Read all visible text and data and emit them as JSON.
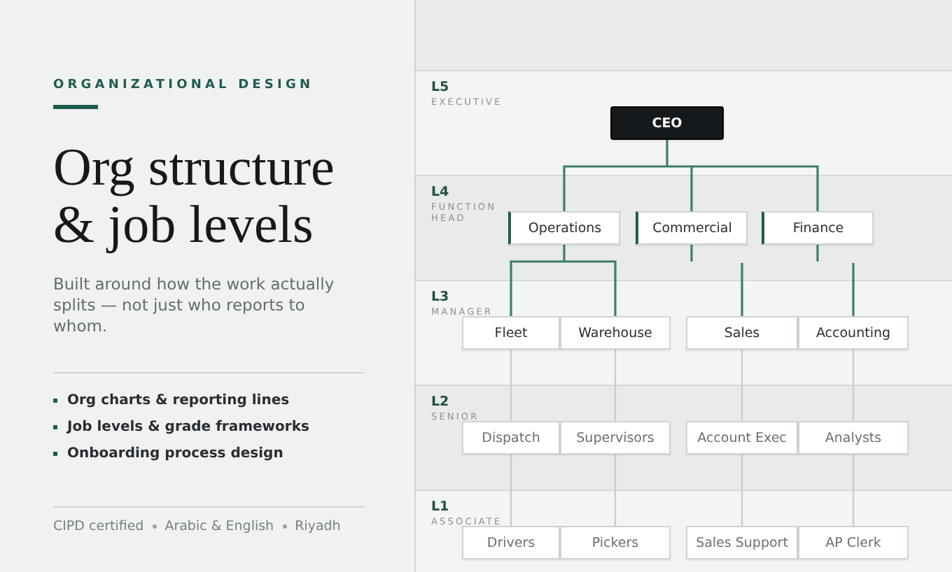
{
  "intro": {
    "eyebrow": "ORGANIZATIONAL DESIGN",
    "title_lines": [
      "Org structure",
      "& job levels"
    ],
    "subtitle": "Built around how the work actually splits — not just who reports to whom.",
    "bullets": [
      "Org charts & reporting lines",
      "Job levels & grade frameworks",
      "Onboarding process design"
    ],
    "footer": [
      "CIPD certified",
      "Arabic & English",
      "Riyadh"
    ]
  },
  "levels": [
    {
      "code": "L5",
      "name": "EXECUTIVE",
      "kind": "executive",
      "nodes": [
        "CEO"
      ]
    },
    {
      "code": "L4",
      "name": "FUNCTION HEAD",
      "kind": "function",
      "nodes": [
        "Operations",
        "Commercial",
        "Finance"
      ]
    },
    {
      "code": "L3",
      "name": "MANAGER",
      "kind": "manager",
      "nodes": [
        "Fleet",
        "Warehouse",
        "Sales",
        "Accounting"
      ]
    },
    {
      "code": "L2",
      "name": "SENIOR",
      "kind": "staff",
      "nodes": [
        "Dispatch",
        "Supervisors",
        "Account Exec",
        "Analysts"
      ]
    },
    {
      "code": "L1",
      "name": "ASSOCIATE",
      "kind": "staff",
      "nodes": [
        "Drivers",
        "Pickers",
        "Sales Support",
        "AP Clerk"
      ]
    }
  ]
}
